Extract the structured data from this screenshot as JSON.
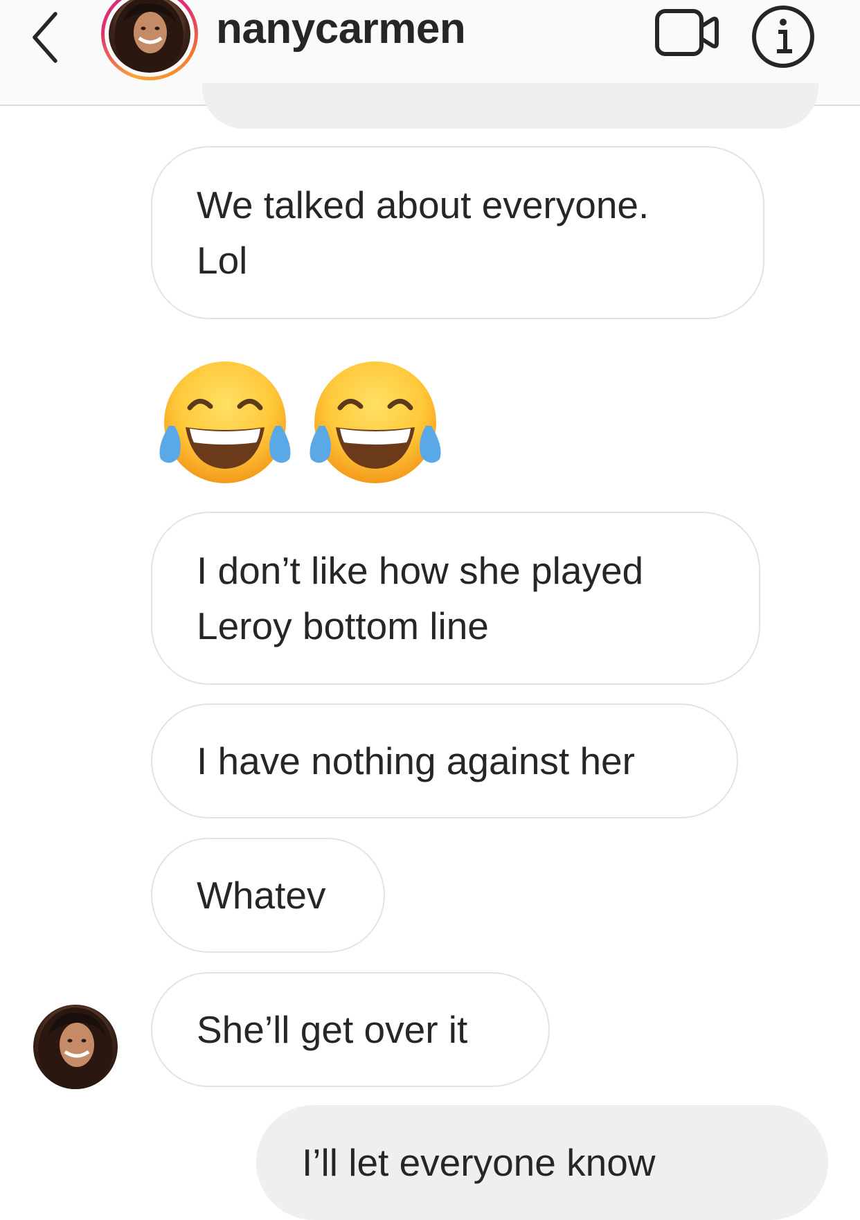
{
  "header": {
    "username": "nanycarmen",
    "back_icon": "chevron-left-icon",
    "video_icon": "video-camera-icon",
    "info_icon": "info-icon"
  },
  "messages": [
    {
      "sender": "them",
      "type": "text",
      "lines": [
        "We talked about everyone.",
        "Lol"
      ]
    },
    {
      "sender": "them",
      "type": "emoji",
      "emoji": [
        "😂",
        "😂"
      ],
      "emoji_name": "face-with-tears-of-joy"
    },
    {
      "sender": "them",
      "type": "text",
      "lines": [
        "I don’t like how she played",
        "Leroy bottom line"
      ]
    },
    {
      "sender": "them",
      "type": "text",
      "lines": [
        "I have nothing against her"
      ]
    },
    {
      "sender": "them",
      "type": "text",
      "lines": [
        "Whatev"
      ]
    },
    {
      "sender": "them",
      "type": "text",
      "lines": [
        "She’ll get over it"
      ]
    },
    {
      "sender": "me",
      "type": "text",
      "lines": [
        "I’ll let everyone know"
      ]
    }
  ],
  "colors": {
    "header_bg": "#fafafa",
    "incoming_border": "#e3e3e3",
    "outgoing_bg": "#efefef",
    "text": "#262626",
    "story_ring_start": "#f9a43a",
    "story_ring_end": "#c13584"
  }
}
